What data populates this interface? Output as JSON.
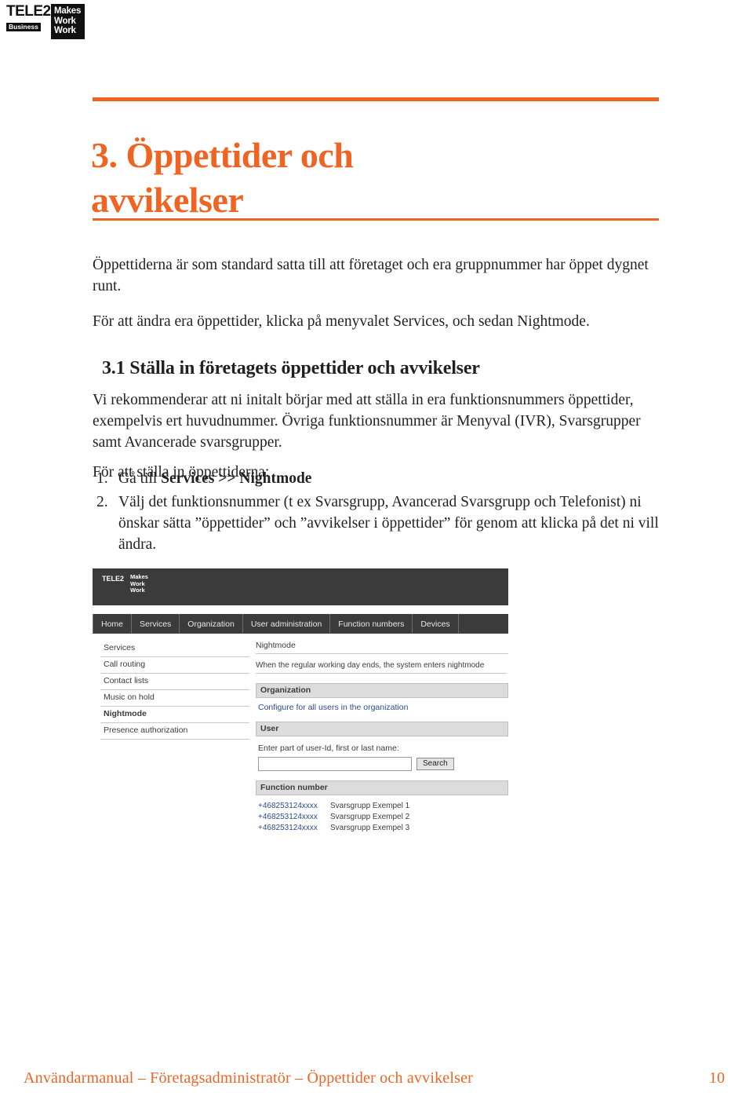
{
  "logo": {
    "brand": "TELE2",
    "brand_sub": "Business",
    "tagline_line1": "Makes",
    "tagline_line2": "Work",
    "tagline_line3": "Work"
  },
  "heading": {
    "line1": "3. Öppettider och",
    "line2": "avvikelser"
  },
  "paragraphs": {
    "p1": "Öppettiderna är som standard satta till att företaget och era gruppnummer har öppet dygnet runt.",
    "p2": "För att ändra era öppettider, klicka på menyvalet Services, och sedan Nightmode.",
    "subheading": "3.1 Ställa in företagets öppettider och avvikelser",
    "p3": "Vi rekommenderar att ni initalt börjar med att ställa in era funktionsnummers öppettider, exempelvis ert huvudnummer. Övriga funktionsnummer är Menyval (IVR), Svarsgrupper samt Avancerade svarsgrupper.",
    "p4": "För att ställa in öppettiderna:"
  },
  "list": [
    {
      "marker": "1.",
      "prefix": "Gå till ",
      "bold": "Services >> Nightmode",
      "suffix": ""
    },
    {
      "marker": "2.",
      "prefix": "Välj det funktionsnummer (t ex Svarsgrupp, Avancerad Svarsgrupp och Telefonist) ni önskar sätta ”öppettider” och ”avvikelser i öppettider” för genom att klicka på det ni vill ändra.",
      "bold": "",
      "suffix": ""
    }
  ],
  "screenshot": {
    "tabs": [
      "Home",
      "Services",
      "Organization",
      "User administration",
      "Function numbers",
      "Devices"
    ],
    "sidebar": [
      {
        "label": "Services",
        "bold": false
      },
      {
        "label": "Call routing",
        "bold": false
      },
      {
        "label": "Contact lists",
        "bold": false
      },
      {
        "label": "Music on hold",
        "bold": false
      },
      {
        "label": "Nightmode",
        "bold": true
      },
      {
        "label": "Presence authorization",
        "bold": false
      }
    ],
    "panel_title": "Nightmode",
    "panel_description": "When the regular working day ends, the system enters nightmode",
    "section_organization": "Organization",
    "organization_link": "Configure for all users in the organization",
    "section_user": "User",
    "user_field_label": "Enter part of user-Id, first or last name:",
    "search_button": "Search",
    "search_value": "",
    "section_function_number": "Function number",
    "function_numbers": [
      {
        "number": "+468253124xxxx",
        "name": "Svarsgrupp Exempel 1"
      },
      {
        "number": "+468253124xxxx",
        "name": "Svarsgrupp Exempel 2"
      },
      {
        "number": "+468253124xxxx",
        "name": "Svarsgrupp Exempel 3"
      }
    ]
  },
  "footer": {
    "text": "Användarmanual – Företagsadministratör – Öppettider och avvikelser",
    "page": "10"
  },
  "colors": {
    "accent": "#f06423",
    "body": "#231f20",
    "screenshot_header": "#3b3b3b",
    "link": "#2b4c8c"
  }
}
